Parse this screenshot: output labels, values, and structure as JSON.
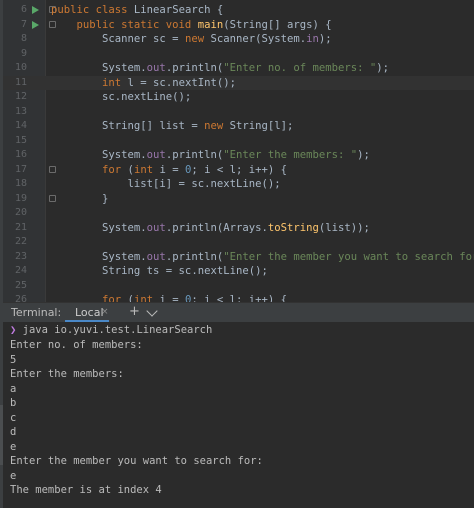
{
  "editor": {
    "lines": [
      {
        "n": "6",
        "run": true,
        "fold": true,
        "seg": [
          {
            "c": "kw",
            "t": "public class "
          },
          {
            "c": "",
            "t": "LinearSearch {"
          }
        ]
      },
      {
        "n": "7",
        "run": true,
        "fold": true,
        "seg": [
          {
            "c": "kw",
            "t": "    public static void "
          },
          {
            "c": "mth",
            "t": "main"
          },
          {
            "c": "",
            "t": "(String[] args) {"
          }
        ]
      },
      {
        "n": "8",
        "seg": [
          {
            "c": "",
            "t": "        Scanner sc = "
          },
          {
            "c": "kw",
            "t": "new "
          },
          {
            "c": "",
            "t": "Scanner(System."
          },
          {
            "c": "fld",
            "t": "in"
          },
          {
            "c": "",
            "t": ");"
          }
        ]
      },
      {
        "n": "9",
        "seg": []
      },
      {
        "n": "10",
        "seg": [
          {
            "c": "",
            "t": "        System."
          },
          {
            "c": "fld",
            "t": "out"
          },
          {
            "c": "",
            "t": ".println("
          },
          {
            "c": "str",
            "t": "\"Enter no. of members: \""
          },
          {
            "c": "",
            "t": ");"
          }
        ]
      },
      {
        "n": "11",
        "current": true,
        "seg": [
          {
            "c": "kw",
            "t": "        int "
          },
          {
            "c": "",
            "t": "l = sc.nextInt();"
          }
        ]
      },
      {
        "n": "12",
        "seg": [
          {
            "c": "",
            "t": "        sc.nextLine();"
          }
        ]
      },
      {
        "n": "13",
        "seg": []
      },
      {
        "n": "14",
        "seg": [
          {
            "c": "",
            "t": "        String[] list = "
          },
          {
            "c": "kw",
            "t": "new "
          },
          {
            "c": "",
            "t": "String[l];"
          }
        ]
      },
      {
        "n": "15",
        "seg": []
      },
      {
        "n": "16",
        "seg": [
          {
            "c": "",
            "t": "        System."
          },
          {
            "c": "fld",
            "t": "out"
          },
          {
            "c": "",
            "t": ".println("
          },
          {
            "c": "str",
            "t": "\"Enter the members: \""
          },
          {
            "c": "",
            "t": ");"
          }
        ]
      },
      {
        "n": "17",
        "fold": true,
        "seg": [
          {
            "c": "kw",
            "t": "        for "
          },
          {
            "c": "",
            "t": "("
          },
          {
            "c": "kw",
            "t": "int "
          },
          {
            "c": "",
            "t": "i = "
          },
          {
            "c": "num",
            "t": "0"
          },
          {
            "c": "",
            "t": "; i < l; i++) {"
          }
        ]
      },
      {
        "n": "18",
        "seg": [
          {
            "c": "",
            "t": "            list[i] = sc.nextLine();"
          }
        ]
      },
      {
        "n": "19",
        "fold": true,
        "seg": [
          {
            "c": "",
            "t": "        }"
          }
        ]
      },
      {
        "n": "20",
        "seg": []
      },
      {
        "n": "21",
        "seg": [
          {
            "c": "",
            "t": "        System."
          },
          {
            "c": "fld",
            "t": "out"
          },
          {
            "c": "",
            "t": ".println(Arrays."
          },
          {
            "c": "mth",
            "t": "toString"
          },
          {
            "c": "",
            "t": "(list));"
          }
        ]
      },
      {
        "n": "22",
        "seg": []
      },
      {
        "n": "23",
        "seg": [
          {
            "c": "",
            "t": "        System."
          },
          {
            "c": "fld",
            "t": "out"
          },
          {
            "c": "",
            "t": ".println("
          },
          {
            "c": "str",
            "t": "\"Enter the member you want to search for: \""
          },
          {
            "c": "",
            "t": ");"
          }
        ]
      },
      {
        "n": "24",
        "seg": [
          {
            "c": "",
            "t": "        String ts = sc.nextLine();"
          }
        ]
      },
      {
        "n": "25",
        "seg": []
      },
      {
        "n": "26",
        "seg": [
          {
            "c": "kw",
            "t": "        for "
          },
          {
            "c": "",
            "t": "("
          },
          {
            "c": "kw",
            "t": "int "
          },
          {
            "c": "",
            "t": "i = "
          },
          {
            "c": "num",
            "t": "0"
          },
          {
            "c": "",
            "t": "; i < l; i++) {"
          }
        ]
      }
    ]
  },
  "terminal": {
    "title": "Terminal:",
    "tab_label": "Local",
    "close_glyph": "×",
    "add_glyph": "+",
    "prompt_glyph": "❯",
    "command": "java io.yuvi.test.LinearSearch",
    "output": [
      "Enter no. of members:",
      "5",
      "Enter the members:",
      "a",
      "b",
      "c",
      "d",
      "e",
      "Enter the member you want to search for:",
      "e",
      "The member is at index 4"
    ]
  }
}
